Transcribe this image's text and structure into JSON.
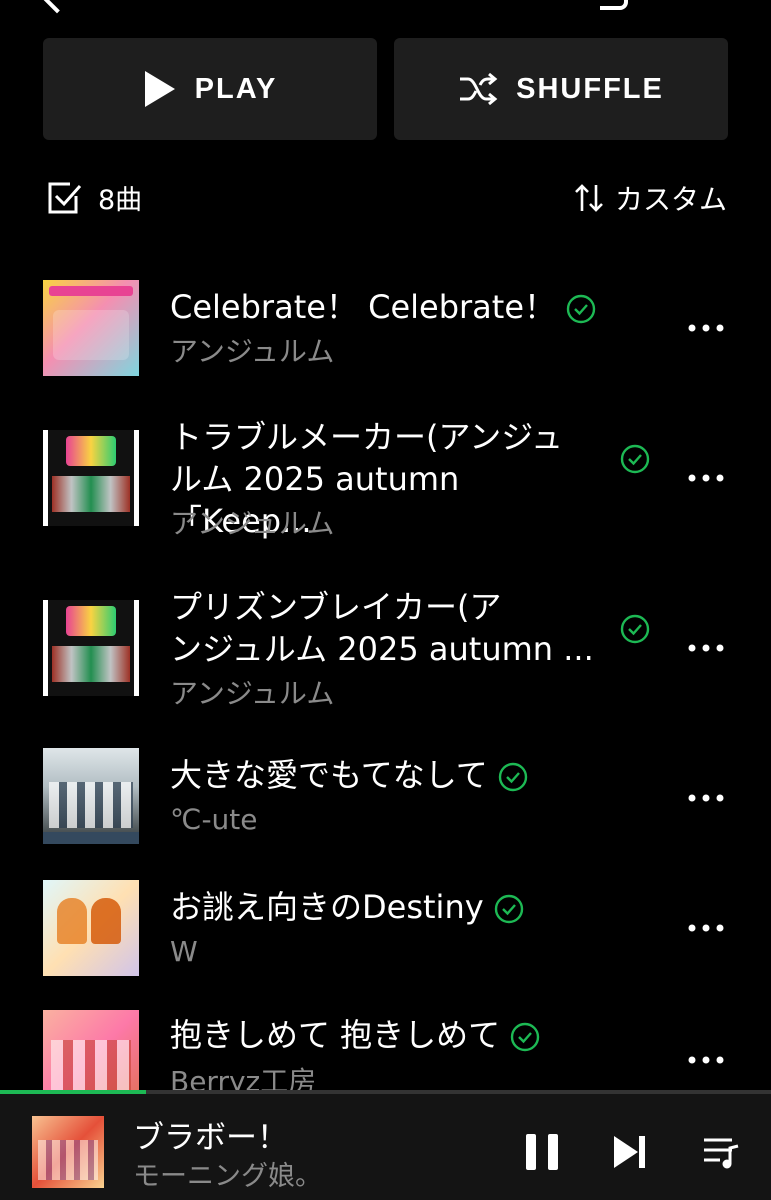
{
  "header": {
    "play_label": "PLAY",
    "shuffle_label": "SHUFFLE"
  },
  "meta": {
    "track_count": "8曲",
    "sort_label": "カスタム"
  },
  "tracks": [
    {
      "title_line1": "Celebrate！ Celebrate！",
      "title_line2": "",
      "artist": "アンジュルム",
      "downloaded": true
    },
    {
      "title_line1": "トラブルメーカー(アンジュ",
      "title_line2": "ルム 2025 autumn 「Keep...",
      "artist": "アンジュルム",
      "downloaded": true
    },
    {
      "title_line1": "プリズンブレイカー(ア",
      "title_line2": "ンジュルム 2025 autumn ...",
      "artist": "アンジュルム",
      "downloaded": true
    },
    {
      "title_line1": "大きな愛でもてなして",
      "title_line2": "",
      "artist": "℃-ute",
      "downloaded": true
    },
    {
      "title_line1": "お誂え向きのDestiny",
      "title_line2": "",
      "artist": "W",
      "downloaded": true
    },
    {
      "title_line1": "抱きしめて 抱きしめて",
      "title_line2": "",
      "artist": "Berryz工房",
      "downloaded": true
    }
  ],
  "now_playing": {
    "title": "ブラボー！",
    "artist": "モーニング娘。",
    "progress": 0.19
  },
  "colors": {
    "accent": "#1db954",
    "background": "#000000",
    "button": "#1e1e1e",
    "secondary_text": "#8a8a8a"
  }
}
